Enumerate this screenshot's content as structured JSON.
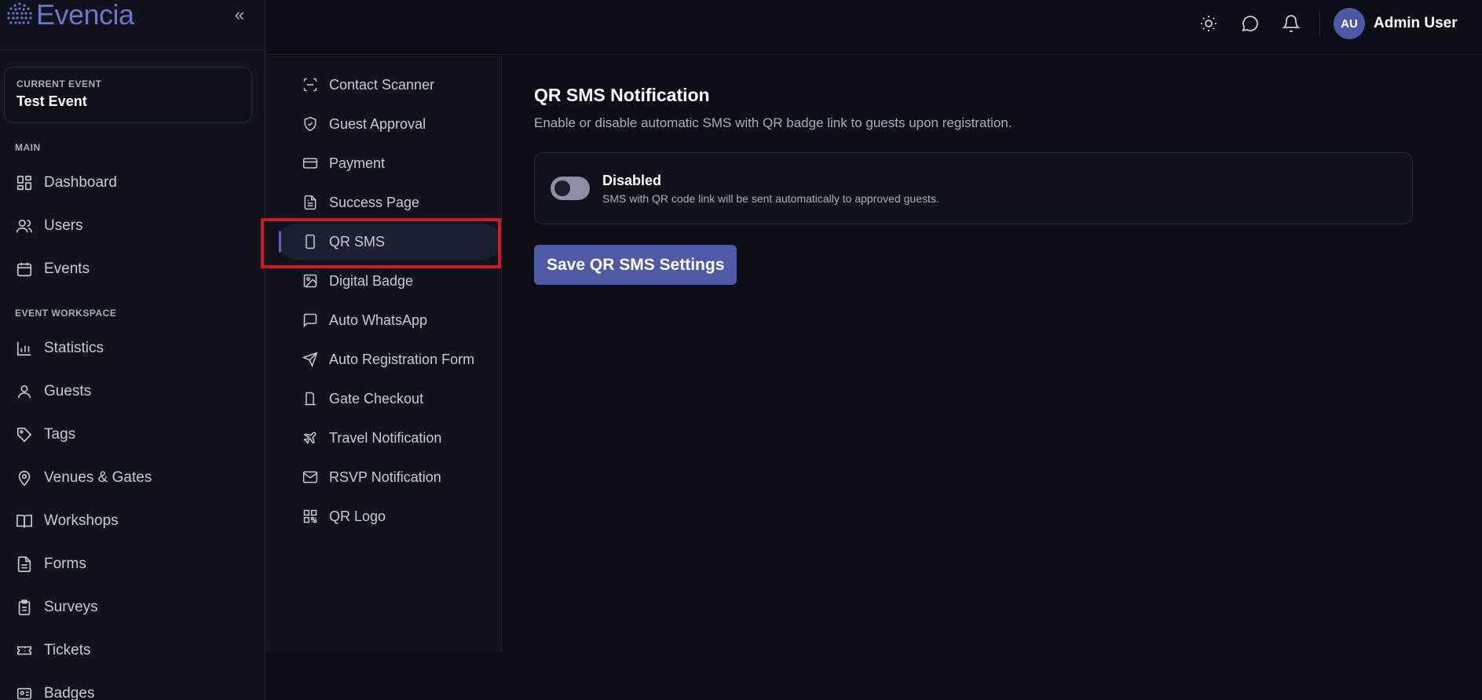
{
  "brand": {
    "name": "Evencia"
  },
  "current_event": {
    "label": "CURRENT EVENT",
    "name": "Test Event"
  },
  "sidebar": {
    "main_title": "MAIN",
    "main_items": [
      {
        "label": "Dashboard",
        "icon": "dashboard-icon"
      },
      {
        "label": "Users",
        "icon": "users-icon"
      },
      {
        "label": "Events",
        "icon": "calendar-icon"
      }
    ],
    "workspace_title": "EVENT WORKSPACE",
    "workspace_items": [
      {
        "label": "Statistics",
        "icon": "bar-chart-icon"
      },
      {
        "label": "Guests",
        "icon": "user-icon"
      },
      {
        "label": "Tags",
        "icon": "tag-icon"
      },
      {
        "label": "Venues & Gates",
        "icon": "map-pin-icon"
      },
      {
        "label": "Workshops",
        "icon": "book-icon"
      },
      {
        "label": "Forms",
        "icon": "file-icon"
      },
      {
        "label": "Surveys",
        "icon": "clipboard-icon"
      },
      {
        "label": "Tickets",
        "icon": "ticket-icon"
      },
      {
        "label": "Badges",
        "icon": "badge-icon"
      }
    ]
  },
  "header": {
    "avatar_initials": "AU",
    "user_name": "Admin User"
  },
  "submenu": {
    "items": [
      {
        "label": "Contact Scanner",
        "icon": "scan-icon"
      },
      {
        "label": "Guest Approval",
        "icon": "shield-check-icon"
      },
      {
        "label": "Payment",
        "icon": "credit-card-icon"
      },
      {
        "label": "Success Page",
        "icon": "file-text-icon"
      },
      {
        "label": "QR SMS",
        "icon": "smartphone-icon"
      },
      {
        "label": "Digital Badge",
        "icon": "image-icon"
      },
      {
        "label": "Auto WhatsApp",
        "icon": "message-square-icon"
      },
      {
        "label": "Auto Registration Form",
        "icon": "send-icon"
      },
      {
        "label": "Gate Checkout",
        "icon": "door-icon"
      },
      {
        "label": "Travel Notification",
        "icon": "plane-icon"
      },
      {
        "label": "RSVP Notification",
        "icon": "mail-icon"
      },
      {
        "label": "QR Logo",
        "icon": "qr-code-icon"
      }
    ],
    "active": "QR SMS"
  },
  "content": {
    "title": "QR SMS Notification",
    "description": "Enable or disable automatic SMS with QR badge link to guests upon registration.",
    "toggle": {
      "state_label": "Disabled",
      "enabled": false,
      "help_text": "SMS with QR code link will be sent automatically to approved guests."
    },
    "save_label": "Save QR SMS Settings"
  },
  "colors": {
    "accent": "#4e5aa6",
    "highlight": "#d11a1f",
    "background": "#0b0e15",
    "panel": "#10131c"
  }
}
